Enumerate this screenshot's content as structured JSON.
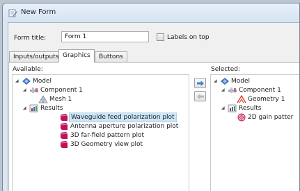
{
  "window": {
    "title": "New Form"
  },
  "form": {
    "title_label": "Form title:",
    "title_value": "Form 1",
    "labels_on_top_label": "Labels on top",
    "labels_on_top_checked": false
  },
  "tabs": [
    {
      "label": "Inputs/outputs",
      "active": false
    },
    {
      "label": "Graphics",
      "active": true
    },
    {
      "label": "Buttons",
      "active": false
    }
  ],
  "available": {
    "header": "Available:",
    "tree": {
      "model": "Model",
      "component": "Component 1",
      "mesh": "Mesh 1",
      "results": "Results",
      "plots": [
        "Waveguide feed polarization plot",
        "Antenna aperture polarization plot",
        "3D far-field pattern plot",
        "3D Geometry view plot"
      ],
      "selected_plot": "Waveguide feed polarization plot"
    }
  },
  "selected": {
    "header": "Selected:",
    "tree": {
      "model": "Model",
      "component": "Component 1",
      "geometry": "Geometry 1",
      "results": "Results",
      "plot": "2D gain patter"
    }
  },
  "move_buttons": {
    "add": "right-arrow-icon",
    "remove": "left-arrow-icon"
  },
  "colors": {
    "accent": "#3b83d6",
    "plot_icon": "#c0125a",
    "selection_bg": "#cde6f7",
    "window_frame": "#dbe6f3"
  }
}
